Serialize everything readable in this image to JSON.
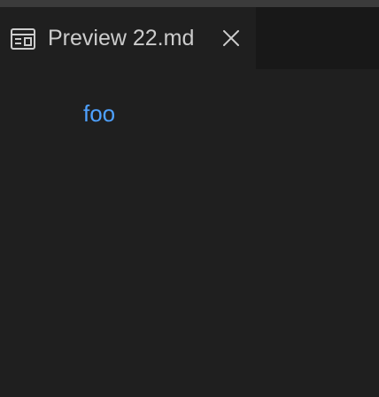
{
  "tabs": [
    {
      "label": "Preview 22.md",
      "icon": "preview-icon",
      "close_icon": "close-icon",
      "active": true
    }
  ],
  "preview": {
    "link_text": "foo"
  },
  "colors": {
    "background": "#1f1f1f",
    "tab_bar": "#181818",
    "top_strip": "#3b3b3b",
    "tab_text": "#cccccc",
    "link": "#4ea1ff"
  }
}
